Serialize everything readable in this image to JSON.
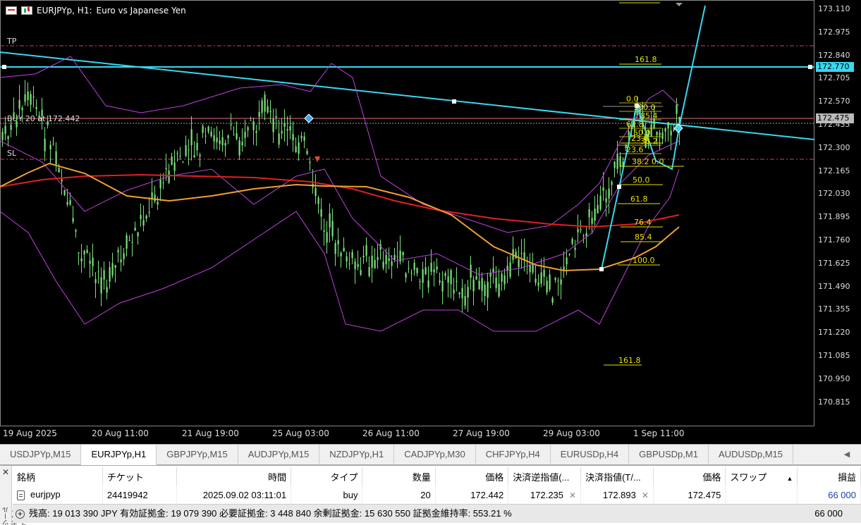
{
  "title": {
    "symbol": "EURJPYp, H1:",
    "description": "Euro vs Japanese Yen"
  },
  "chart": {
    "tp_label": "TP",
    "sl_label": "SL",
    "buy_label": "BUY 20 at 172.442",
    "price_ticks": [
      "173.110",
      "172.975",
      "172.840",
      "172.705",
      "172.570",
      "172.435",
      "172.300",
      "172.165",
      "172.030",
      "171.895",
      "171.760",
      "171.625",
      "171.490",
      "171.355",
      "171.220",
      "171.085",
      "170.950",
      "170.815"
    ],
    "price_tags": {
      "level": "172.770",
      "current": "172.475"
    },
    "time_ticks": [
      "19 Aug 2025",
      "20 Aug 11:00",
      "21 Aug 19:00",
      "25 Aug 03:00",
      "26 Aug 11:00",
      "27 Aug 19:00",
      "29 Aug 03:00",
      "1 Sep 11:00"
    ],
    "fib_levels": [
      "161.8",
      "100.0",
      "85.4",
      "76.4",
      "61.8",
      "50.0",
      "38.2",
      "23.6",
      "0.0"
    ],
    "fib_small": [
      "0.0",
      "100.0",
      "85.4",
      "61.8",
      "50.0",
      "38.2",
      "23.6"
    ],
    "fib_bottom": "161.8",
    "fib_top": "161.8",
    "colors": {
      "candle": "#7be37b",
      "ma_red": "#e02020",
      "ma_orange": "#f0a030",
      "bands": "#c040e0",
      "trend": "#38d8ef",
      "fib": "#e6e000",
      "level_line": "#e04050"
    }
  },
  "tabs": [
    {
      "label": "USDJPYp,M15",
      "active": false
    },
    {
      "label": "EURJPYp,H1",
      "active": true
    },
    {
      "label": "GBPJPYp,M15",
      "active": false
    },
    {
      "label": "AUDJPYp,M15",
      "active": false
    },
    {
      "label": "NZDJPYp,H1",
      "active": false
    },
    {
      "label": "CADJPYp,M30",
      "active": false
    },
    {
      "label": "CHFJPYp,H4",
      "active": false
    },
    {
      "label": "EURUSDp,H4",
      "active": false
    },
    {
      "label": "GBPUSDp,M1",
      "active": false
    },
    {
      "label": "AUDUSDp,M15",
      "active": false
    }
  ],
  "terminal": {
    "side_label": "ツールボックス",
    "headers": [
      "銘柄",
      "チケット",
      "時間",
      "タイプ",
      "数量",
      "価格",
      "決済逆指値(...",
      "決済指値(T/...",
      "価格",
      "スワップ",
      "損益"
    ],
    "row": {
      "symbol": "eurjpyp",
      "ticket": "24419942",
      "time": "2025.09.02 03:11:01",
      "type": "buy",
      "volume": "20",
      "open_price": "172.442",
      "sl": "172.235",
      "tp": "172.893",
      "price": "172.475",
      "swap": "",
      "profit": "66 000"
    },
    "summary": "残高: 19 013 390 JPY  有効証拠金: 19 079 390  必要証拠金: 3 448 840  余剰証拠金: 15 630 550  証拠金維持率: 553.21 %",
    "summary_total": "66 000"
  }
}
